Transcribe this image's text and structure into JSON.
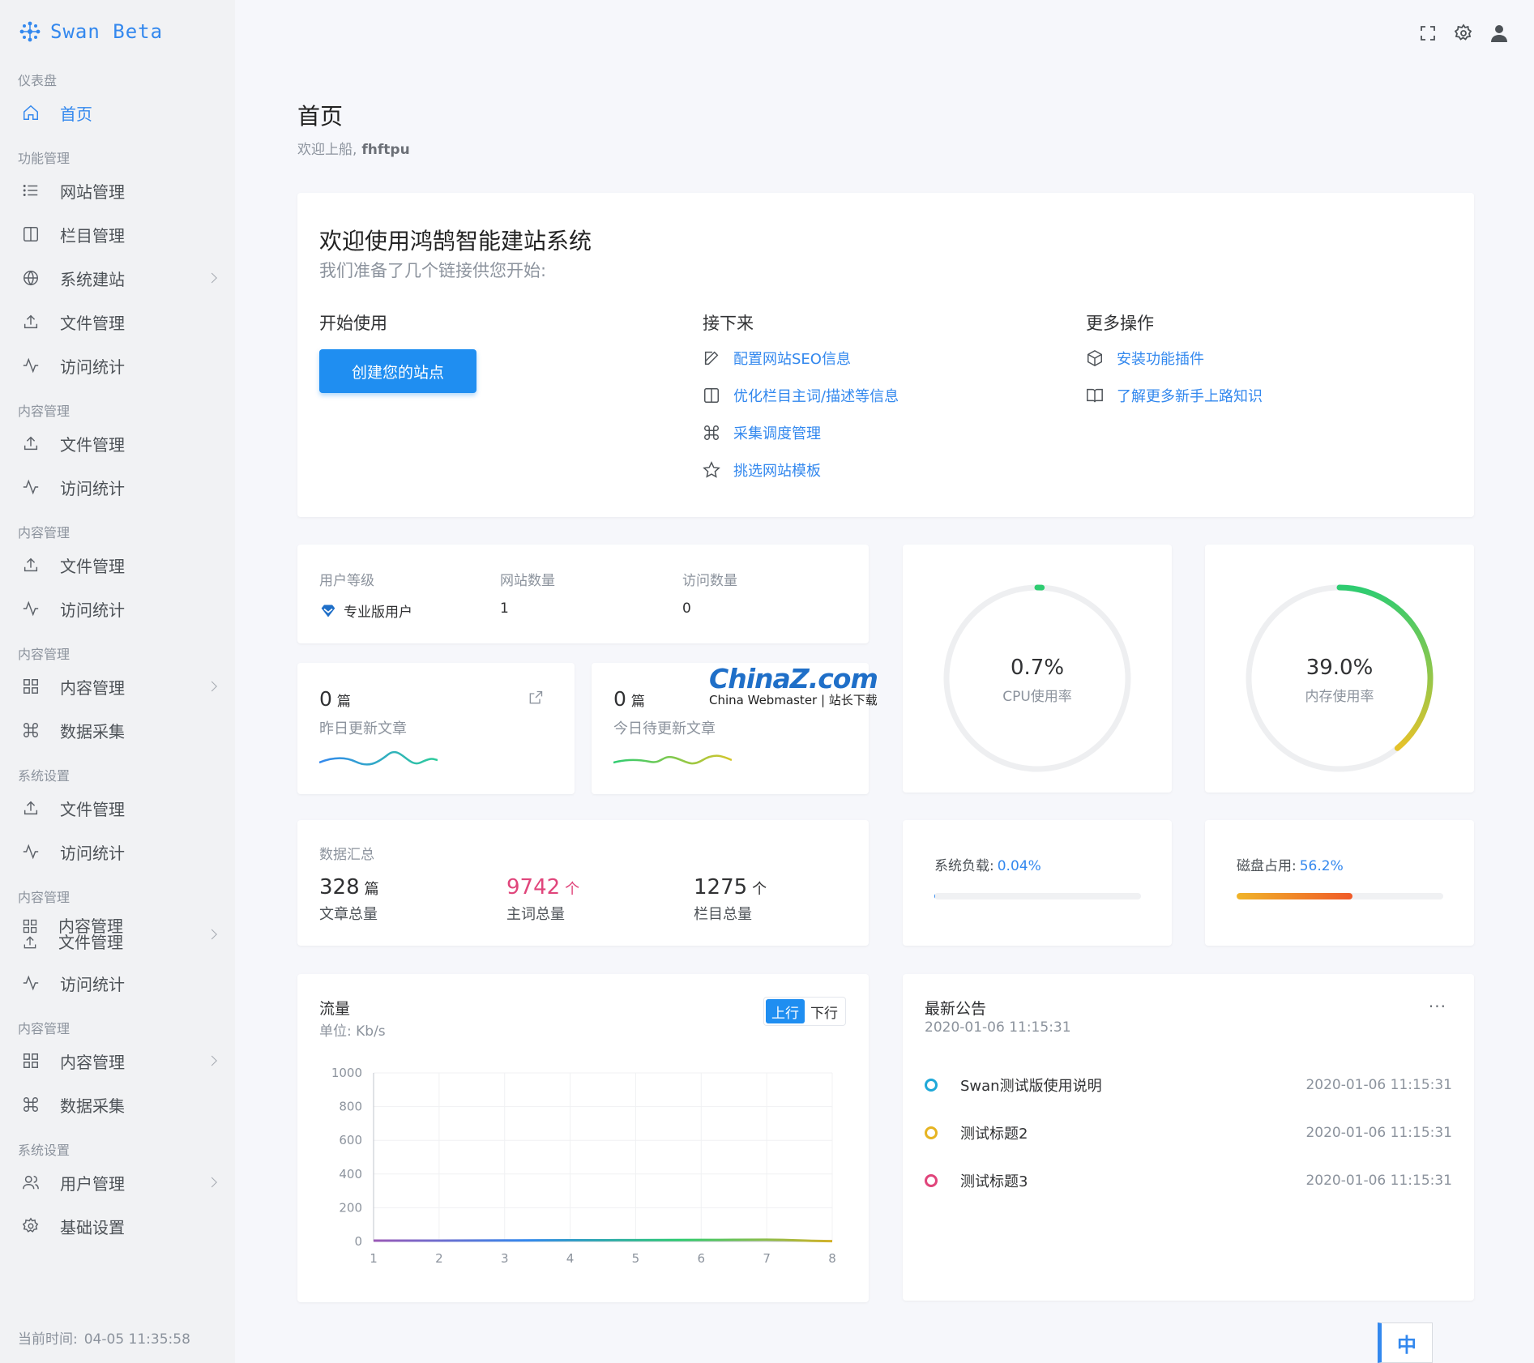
{
  "app": {
    "name": "Swan Beta"
  },
  "sidebar": {
    "sections": [
      {
        "group": "仪表盘",
        "items": [
          {
            "label": "首页",
            "icon": "home-icon",
            "active": true
          }
        ]
      },
      {
        "group": "功能管理",
        "items": [
          {
            "label": "网站管理",
            "icon": "list-icon"
          },
          {
            "label": "栏目管理",
            "icon": "columns-icon"
          },
          {
            "label": "系统建站",
            "icon": "globe-icon",
            "arrow": true
          },
          {
            "label": "文件管理",
            "icon": "upload-icon"
          },
          {
            "label": "访问统计",
            "icon": "activity-icon"
          }
        ]
      },
      {
        "group": "内容管理",
        "items": [
          {
            "label": "文件管理",
            "icon": "upload-icon"
          },
          {
            "label": "访问统计",
            "icon": "activity-icon"
          }
        ]
      },
      {
        "group": "内容管理",
        "items": [
          {
            "label": "文件管理",
            "icon": "upload-icon"
          },
          {
            "label": "访问统计",
            "icon": "activity-icon"
          }
        ]
      },
      {
        "group": "内容管理",
        "items": [
          {
            "label": "内容管理",
            "icon": "grid-icon",
            "arrow": true
          },
          {
            "label": "数据采集",
            "icon": "command-icon"
          }
        ]
      },
      {
        "group": "系统设置",
        "items": [
          {
            "label": "文件管理",
            "icon": "upload-icon"
          },
          {
            "label": "访问统计",
            "icon": "activity-icon"
          }
        ]
      },
      {
        "group": "内容管理",
        "items": [
          {
            "label": "内容管理",
            "label2": "文件管理",
            "icon": "grid-icon",
            "icon2": "upload-icon",
            "arrow": true
          },
          {
            "label": "访问统计",
            "icon": "activity-icon"
          }
        ]
      },
      {
        "group": "内容管理",
        "items": [
          {
            "label": "内容管理",
            "icon": "grid-icon",
            "arrow": true
          },
          {
            "label": "数据采集",
            "icon": "command-icon"
          }
        ]
      },
      {
        "group": "系统设置",
        "items": [
          {
            "label": "用户管理",
            "icon": "users-icon",
            "arrow": true
          },
          {
            "label": "基础设置",
            "icon": "gear-icon"
          }
        ]
      }
    ],
    "current_time_label": "当前时间:",
    "current_time": "04-05 11:35:58"
  },
  "header": {
    "icons": [
      "fullscreen-icon",
      "gear-icon",
      "user-icon"
    ]
  },
  "page": {
    "title": "首页",
    "welcome_prefix": "欢迎上船,",
    "username": "fhftpu"
  },
  "welcome": {
    "title": "欢迎使用鸿鹄智能建站系统",
    "subtitle": "我们准备了几个链接供您开始:",
    "start": {
      "title": "开始使用",
      "button": "创建您的站点"
    },
    "next": {
      "title": "接下来",
      "links": [
        {
          "label": "配置网站SEO信息",
          "icon": "edit-icon"
        },
        {
          "label": "优化栏目主词/描述等信息",
          "icon": "columns-icon"
        },
        {
          "label": "采集调度管理",
          "icon": "command-icon"
        },
        {
          "label": "挑选网站模板",
          "icon": "star-icon"
        }
      ]
    },
    "more": {
      "title": "更多操作",
      "links": [
        {
          "label": "安装功能插件",
          "icon": "box-icon"
        },
        {
          "label": "了解更多新手上路知识",
          "icon": "book-icon"
        }
      ]
    }
  },
  "user_stats": {
    "level_label": "用户等级",
    "level_value": "专业版用户",
    "sites_label": "网站数量",
    "sites_value": "1",
    "visits_label": "访问数量",
    "visits_value": "0"
  },
  "articles": {
    "yesterday": {
      "count": "0",
      "unit": "篇",
      "label": "昨日更新文章"
    },
    "today": {
      "count": "0",
      "unit": "篇",
      "label": "今日待更新文章"
    }
  },
  "gauges": {
    "cpu": {
      "value_text": "0.7%",
      "value": 0.7,
      "label": "CPU使用率"
    },
    "mem": {
      "value_text": "39.0%",
      "value": 39.0,
      "label": "内存使用率"
    }
  },
  "summary": {
    "title": "数据汇总",
    "articles": {
      "count": "328",
      "unit": "篇",
      "label": "文章总量"
    },
    "keywords": {
      "count": "9742",
      "unit": "个",
      "label": "主词总量"
    },
    "columns": {
      "count": "1275",
      "unit": "个",
      "label": "栏目总量"
    }
  },
  "load": {
    "label": "系统负载:",
    "value_text": "0.04%",
    "value": 0.04
  },
  "disk": {
    "label": "磁盘占用:",
    "value_text": "56.2%",
    "value": 56.2
  },
  "traffic": {
    "title": "流量",
    "unit": "单位: Kb/s",
    "toggle": {
      "up": "上行",
      "down": "下行",
      "selected": "up"
    }
  },
  "chart_data": {
    "type": "line",
    "x": [
      1,
      2,
      3,
      4,
      5,
      6,
      7,
      8
    ],
    "series": [
      {
        "values": [
          5,
          5,
          6,
          7,
          8,
          9,
          10,
          2
        ]
      }
    ],
    "ylim": [
      0,
      1000
    ],
    "yticks": [
      0,
      200,
      400,
      600,
      800,
      1000
    ],
    "grid": true,
    "colors": [
      "#9b59b6",
      "#3388ee",
      "#2ecc71",
      "#d4b12a"
    ]
  },
  "notices": {
    "title": "最新公告",
    "date": "2020-01-06 11:15:31",
    "more": "···",
    "items": [
      {
        "title": "Swan测试版使用说明",
        "date": "2020-01-06 11:15:31",
        "color": "#1fa8d8"
      },
      {
        "title": "测试标题2",
        "date": "2020-01-06 11:15:31",
        "color": "#e6b422"
      },
      {
        "title": "测试标题3",
        "date": "2020-01-06 11:15:31",
        "color": "#e0457b"
      }
    ]
  },
  "watermark": {
    "line1": "ChinaZ.com",
    "line2": "China Webmaster | 站长下载"
  },
  "lang_button": "中"
}
